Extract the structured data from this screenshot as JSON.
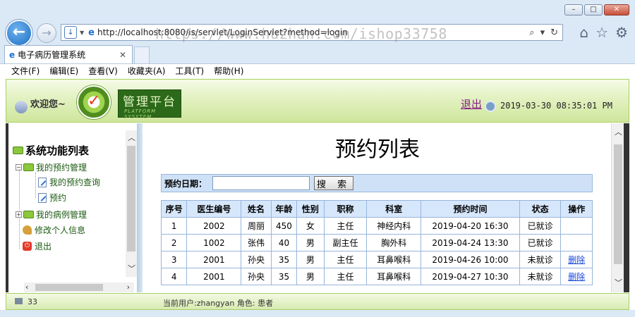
{
  "browser": {
    "url": "http://localhost:8080/is/servlet/LoginServlet?method=login",
    "watermark": "https://www.huzhan.com/ishop33758",
    "tab_title": "电子病历管理系统",
    "menu": [
      "文件(F)",
      "编辑(E)",
      "查看(V)",
      "收藏夹(A)",
      "工具(T)",
      "帮助(H)"
    ]
  },
  "header": {
    "welcome": "欢迎您~",
    "brand_cn": "管理平台",
    "brand_en": "PLATFORM SYSYTEM",
    "logout": "退出",
    "datetime": "2019-03-30 08:35:01 PM"
  },
  "sidebar": {
    "root": "系统功能列表",
    "groups": [
      {
        "label": "我的预约管理",
        "items": [
          "我的预约查询",
          "预约"
        ]
      },
      {
        "label": "我的病例管理",
        "items": []
      }
    ],
    "profile": "修改个人信息",
    "exit": "退出"
  },
  "main": {
    "title": "预约列表",
    "search": {
      "label": "预约日期：",
      "value": "",
      "button": "搜 索"
    },
    "columns": [
      "序号",
      "医生编号",
      "姓名",
      "年龄",
      "性别",
      "职称",
      "科室",
      "预约时间",
      "状态",
      "操作"
    ],
    "rows": [
      [
        "1",
        "2002",
        "周丽",
        "450",
        "女",
        "主任",
        "神经内科",
        "2019-04-20  16:30",
        "已就诊",
        ""
      ],
      [
        "2",
        "1002",
        "张伟",
        "40",
        "男",
        "副主任",
        "胸外科",
        "2019-04-24  13:30",
        "已就诊",
        ""
      ],
      [
        "3",
        "2001",
        "孙央",
        "35",
        "男",
        "主任",
        "耳鼻喉科",
        "2019-04-26  10:00",
        "未就诊",
        "删除"
      ],
      [
        "4",
        "2001",
        "孙央",
        "35",
        "男",
        "主任",
        "耳鼻喉科",
        "2019-04-27  10:30",
        "未就诊",
        "删除"
      ]
    ]
  },
  "footer": {
    "count": "33",
    "user": "当前用户:zhangyan  角色: 患者"
  },
  "colors": {
    "header_green": "#cfe69c",
    "table_header": "#d7e7fb",
    "link": "#1846d8"
  }
}
